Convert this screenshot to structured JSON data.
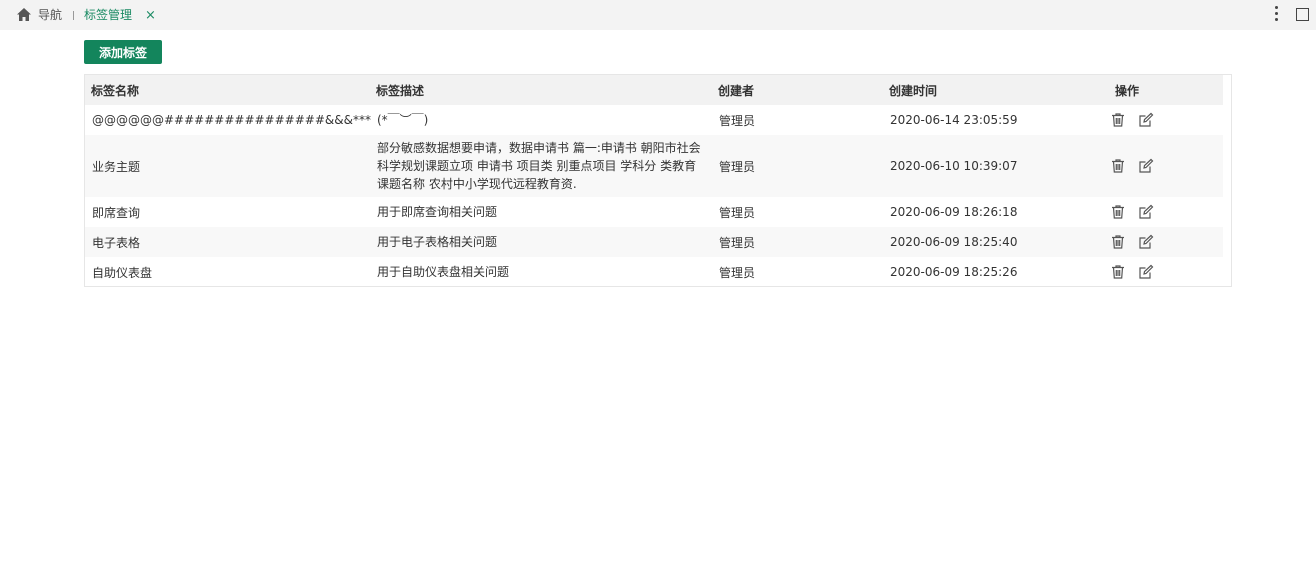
{
  "topbar": {
    "icons": {
      "home": "home-icon",
      "more": "more-vertical-icon",
      "maximize": "maximize-icon",
      "close": "close-icon"
    },
    "nav_label": "导航",
    "active_tab": "标签管理",
    "tab_close": "×"
  },
  "toolbar": {
    "add_label": "添加标签"
  },
  "table": {
    "columns": [
      "标签名称",
      "标签描述",
      "创建者",
      "创建时间",
      "操作"
    ],
    "row_icons": [
      "trash-icon",
      "edit-icon"
    ],
    "rows": [
      {
        "name": "@@@@@@################&&&***",
        "desc": "(*￣︶￣)",
        "creator": "管理员",
        "time": "2020-06-14 23:05:59"
      },
      {
        "name": "业务主题",
        "desc": "部分敏感数据想要申请，数据申请书 篇一:申请书 朝阳市社会科学规划课题立项 申请书 项目类 别重点项目 学科分 类教育课题名称 农村中小学现代远程教育资.",
        "creator": "管理员",
        "time": "2020-06-10 10:39:07"
      },
      {
        "name": "即席查询",
        "desc": "用于即席查询相关问题",
        "creator": "管理员",
        "time": "2020-06-09 18:26:18"
      },
      {
        "name": "电子表格",
        "desc": "用于电子表格相关问题",
        "creator": "管理员",
        "time": "2020-06-09 18:25:40"
      },
      {
        "name": "自助仪表盘",
        "desc": "用于自助仪表盘相关问题",
        "creator": "管理员",
        "time": "2020-06-09 18:25:26"
      }
    ]
  },
  "colors": {
    "accent": "#13855c",
    "tab_text": "#1a8a63",
    "header_bg": "#f2f2f2",
    "topbar_bg": "#f3f3f3"
  }
}
